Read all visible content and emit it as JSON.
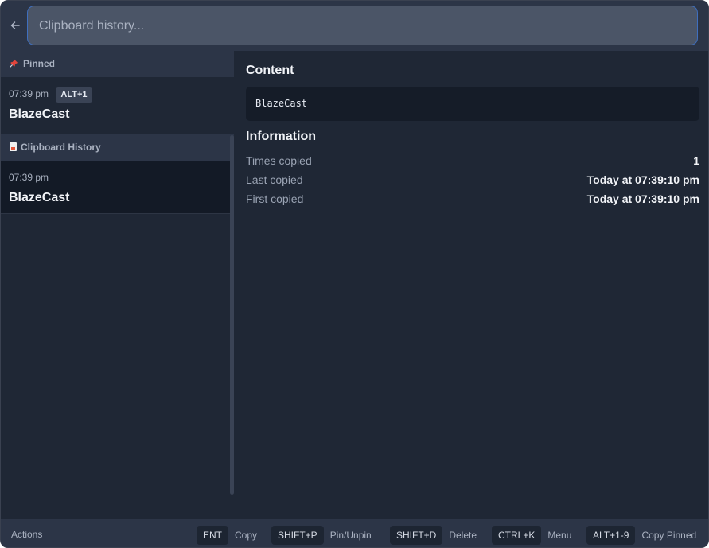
{
  "search": {
    "placeholder": "Clipboard history...",
    "value": ""
  },
  "sections": {
    "pinned_label": "Pinned",
    "history_label": "Clipboard History"
  },
  "pinned_items": [
    {
      "time": "07:39 pm",
      "shortcut": "ALT+1",
      "title": "BlazeCast"
    }
  ],
  "history_items": [
    {
      "time": "07:39 pm",
      "title": "BlazeCast"
    }
  ],
  "detail": {
    "content_heading": "Content",
    "content_text": "BlazeCast",
    "info_heading": "Information",
    "rows": [
      {
        "label": "Times copied",
        "value": "1"
      },
      {
        "label": "Last copied",
        "value": "Today at 07:39:10 pm"
      },
      {
        "label": "First copied",
        "value": "Today at 07:39:10 pm"
      }
    ]
  },
  "footer": {
    "actions_label": "Actions",
    "hints": [
      {
        "key": "ENT",
        "label": "Copy"
      },
      {
        "key": "SHIFT+P",
        "label": "Pin/Unpin"
      },
      {
        "key": "SHIFT+D",
        "label": "Delete"
      },
      {
        "key": "CTRL+K",
        "label": "Menu"
      },
      {
        "key": "ALT+1-9",
        "label": "Copy Pinned"
      }
    ]
  },
  "icons": {
    "back": "arrow-left-icon",
    "pinned": "pushpin-icon",
    "history": "document-icon"
  },
  "colors": {
    "background": "#1f2735",
    "panel": "#2c3547",
    "selected": "#131a26",
    "accent_border": "#3f6fbf",
    "pin_red": "#e2453c"
  }
}
